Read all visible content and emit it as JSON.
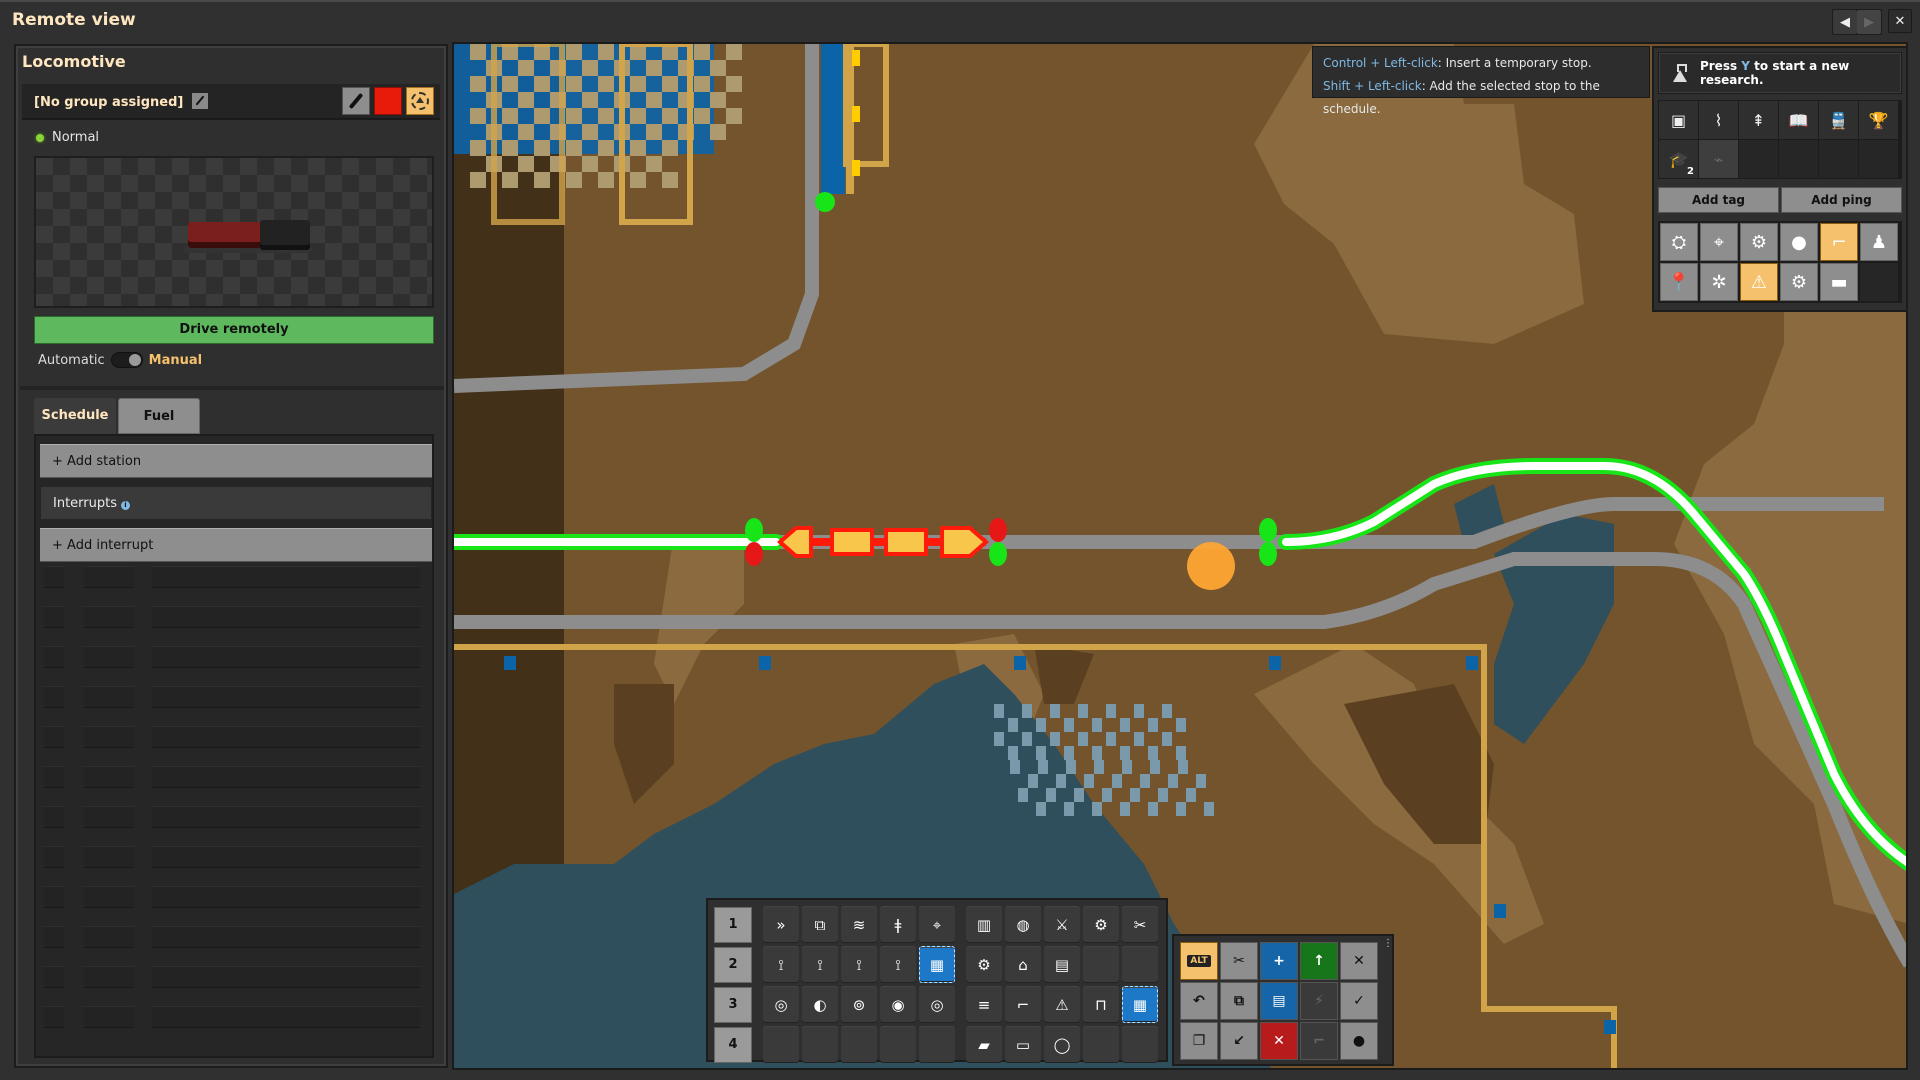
{
  "window": {
    "title": "Remote view",
    "buttons": {
      "back": "◀",
      "forward": "▶",
      "close": "✕"
    }
  },
  "locomotive_panel": {
    "title": "Locomotive",
    "group_label": "[No group assigned]",
    "status": "Normal",
    "status_color": "#8cd33a",
    "locomotive_color": "#e81b0b",
    "drive_button": "Drive remotely",
    "mode": {
      "automatic_label": "Automatic",
      "manual_label": "Manual",
      "selected": "Manual"
    },
    "tabs": [
      {
        "label": "Schedule",
        "active": true
      },
      {
        "label": "Fuel",
        "active": false
      }
    ],
    "schedule": {
      "add_station": "+ Add station",
      "interrupts_label": "Interrupts",
      "add_interrupt": "+ Add interrupt"
    }
  },
  "tooltip": {
    "line1_key": "Control + Left-click",
    "line1_text": ": Insert a temporary stop.",
    "line2_key": "Shift + Left-click",
    "line2_text": ": Add the selected stop to the schedule."
  },
  "research_panel": {
    "prefix": "Press ",
    "key": "Y",
    "suffix": " to start a new research.",
    "shortcuts_row1": [
      "selection-icon",
      "production-stats-icon",
      "upgrade-icon",
      "factoriopedia-icon",
      "trains-icon",
      "achievements-icon"
    ],
    "shortcut_glyphs_row1": [
      "▣",
      "⌇",
      "⇞",
      "📖",
      "🚆",
      "🏆"
    ],
    "tips_badge": "2",
    "add_tag": "Add tag",
    "add_ping": "Add ping",
    "ping_icons": [
      {
        "name": "roboport-icon",
        "glyph": "⛭",
        "selected": false
      },
      {
        "name": "big-electric-pole-icon",
        "glyph": "⌖",
        "selected": false
      },
      {
        "name": "assembler-icon",
        "glyph": "⚙",
        "selected": false
      },
      {
        "name": "flame-icon",
        "glyph": "●",
        "selected": false
      },
      {
        "name": "rail-signal-icon",
        "glyph": "⌐",
        "selected": true
      },
      {
        "name": "engineer-icon",
        "glyph": "♟",
        "selected": false
      },
      {
        "name": "map-pin-icon",
        "glyph": "📍",
        "selected": false
      },
      {
        "name": "spidertron-icon",
        "glyph": "✲",
        "selected": false
      },
      {
        "name": "chain-signal-icon",
        "glyph": "⚠",
        "selected": true
      },
      {
        "name": "circuit-icon",
        "glyph": "⚙",
        "selected": false
      },
      {
        "name": "train-stop-icon",
        "glyph": "▬",
        "selected": false
      }
    ]
  },
  "quickbar": {
    "rows": [
      {
        "num": "1",
        "slots": [
          "express-belt",
          "splitter",
          "inserter-stack",
          "small-pole",
          "big-pole",
          "wooden-chest",
          "grenade",
          "turret",
          "assembler",
          "repair-pack"
        ]
      },
      {
        "num": "2",
        "slots": [
          "inserter",
          "fast-inserter",
          "long-inserter",
          "bulk-inserter",
          "blueprint",
          "gears",
          "lab",
          "furnace",
          "",
          ""
        ]
      },
      {
        "num": "3",
        "slots": [
          "pipe",
          "pipe-to-ground",
          "pump",
          "offshore-pump",
          "storage-tank",
          "rail",
          "rail-signal",
          "chain-signal",
          "train-stop",
          "blueprint"
        ]
      },
      {
        "num": "4",
        "slots": [
          "",
          "",
          "",
          "",
          "",
          "locomotive",
          "cargo-wagon",
          "fluid-wagon",
          "",
          ""
        ]
      }
    ],
    "glyphs": {
      "express-belt": "»",
      "splitter": "⧉",
      "inserter-stack": "≋",
      "small-pole": "ǂ",
      "big-pole": "⌖",
      "wooden-chest": "▥",
      "grenade": "◍",
      "turret": "⚔",
      "assembler": "⚙",
      "repair-pack": "✂",
      "inserter": "⟟",
      "fast-inserter": "⟟",
      "long-inserter": "⟟",
      "bulk-inserter": "⟟",
      "blueprint": "▦",
      "gears": "⚙",
      "lab": "⌂",
      "furnace": "▤",
      "pipe": "◎",
      "pipe-to-ground": "◐",
      "pump": "⊚",
      "offshore-pump": "◉",
      "storage-tank": "◎",
      "rail": "≡",
      "rail-signal": "⌐",
      "chain-signal": "⚠",
      "train-stop": "⊓",
      "locomotive": "▰",
      "cargo-wagon": "▭",
      "fluid-wagon": "◯"
    }
  },
  "toolpanel": {
    "alt_label": "ALT",
    "tools": [
      {
        "name": "alt-mode-toggle",
        "style": "alt",
        "glyph": "ALT"
      },
      {
        "name": "cut-tool",
        "style": "",
        "glyph": "✂"
      },
      {
        "name": "copy-tool",
        "style": "blue",
        "glyph": "+"
      },
      {
        "name": "blueprint-tool",
        "style": "green",
        "glyph": "↑"
      },
      {
        "name": "deconstruction-tool",
        "style": "",
        "glyph": "✕"
      },
      {
        "name": "undo-tool",
        "style": "",
        "glyph": "↶"
      },
      {
        "name": "paste-tool",
        "style": "",
        "glyph": "⧉"
      },
      {
        "name": "blueprint-book-tool",
        "style": "blue",
        "glyph": "▤"
      },
      {
        "name": "artillery-tool",
        "style": "dark",
        "glyph": "⚡"
      },
      {
        "name": "upgrade-tool",
        "style": "",
        "glyph": "✓"
      },
      {
        "name": "redo-tool",
        "style": "",
        "glyph": "❐"
      },
      {
        "name": "copy-settings-tool",
        "style": "",
        "glyph": "↙"
      },
      {
        "name": "cancel-deconstruct-tool",
        "style": "red",
        "glyph": "✕"
      },
      {
        "name": "remote-tool",
        "style": "dark",
        "glyph": "⌐"
      },
      {
        "name": "cancel-upgrade-tool",
        "style": "",
        "glyph": "●"
      }
    ]
  },
  "map_colors": {
    "ground": "#73542c",
    "ground_light": "#8a6a3e",
    "ground_dark": "#5a4020",
    "water": "#2f4f5c",
    "rail": "#8d8d8d",
    "path": "#ffffff",
    "path_outline": "#17e517",
    "signal_green": "#17e517",
    "signal_red": "#e51717",
    "train_fill": "#f8c64a",
    "train_outline": "#ff1a0a",
    "wall": "#d2a44a",
    "pole_blue": "#0c64a8",
    "player_marker": "#ffa534"
  }
}
